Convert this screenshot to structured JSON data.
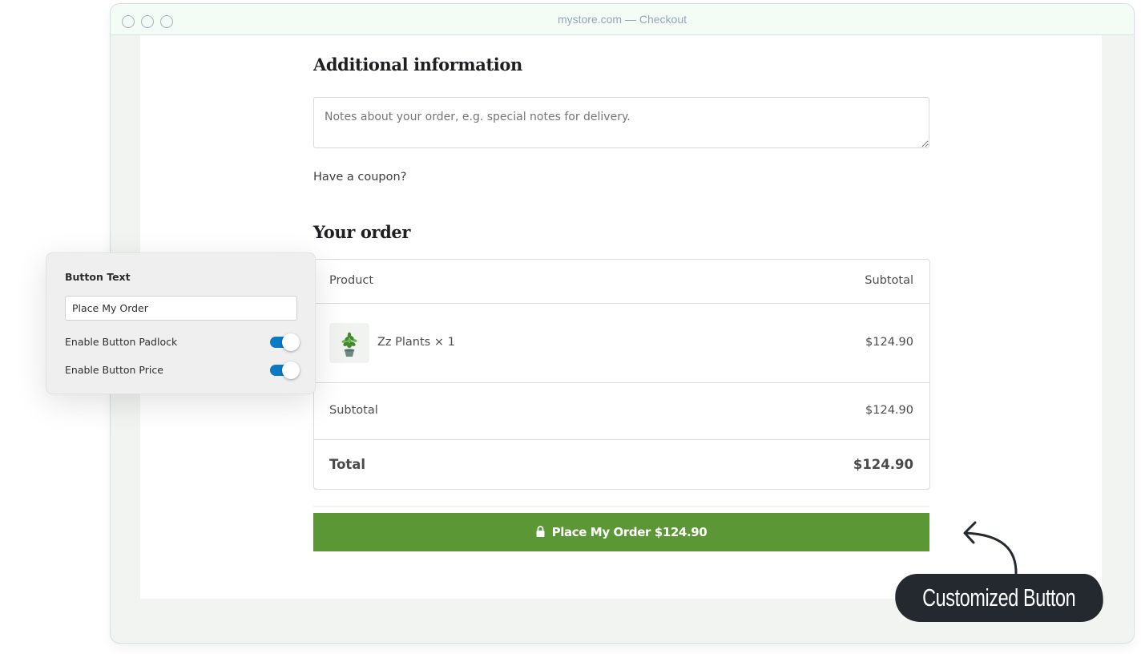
{
  "window": {
    "title": "mystore.com — Checkout"
  },
  "checkout": {
    "additional_heading": "Additional information",
    "notes_placeholder": "Notes about your order, e.g. special notes for delivery.",
    "notes_value": "",
    "coupon_link": "Have a coupon?",
    "order_heading": "Your order",
    "table": {
      "headers": {
        "product": "Product",
        "subtotal": "Subtotal"
      },
      "items": [
        {
          "name": "Zz Plants × 1",
          "price": "$124.90",
          "thumbnail": "plant-image"
        }
      ],
      "subtotal_label": "Subtotal",
      "subtotal_value": "$124.90",
      "total_label": "Total",
      "total_value": "$124.90"
    },
    "place_order_button": {
      "label": "Place My Order $124.90",
      "icon": "padlock-icon",
      "color": "#5b9734"
    }
  },
  "settings_panel": {
    "button_text_label": "Button Text",
    "button_text_value": "Place My Order",
    "toggles": [
      {
        "label": "Enable Button Padlock",
        "enabled": true
      },
      {
        "label": "Enable Button Price",
        "enabled": true
      }
    ],
    "toggle_color": "#0a7ac4"
  },
  "annotation": {
    "label": "Customized Button",
    "icon": "curved-arrow-icon"
  }
}
